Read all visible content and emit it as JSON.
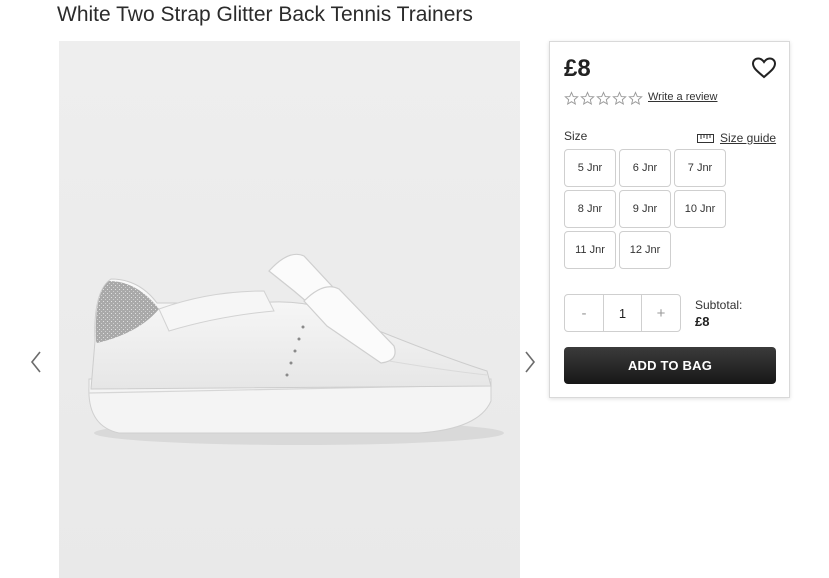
{
  "product": {
    "title": "White Two Strap Glitter Back Tennis Trainers",
    "image_icon": "product-image-white-trainer",
    "gallery_prev_icon": "chevron-left-icon",
    "gallery_next_icon": "chevron-right-icon"
  },
  "panel": {
    "price": "£8",
    "wishlist_icon": "heart-icon",
    "rating": {
      "stars_filled": 0,
      "stars_total": 5,
      "review_link": "Write a review"
    },
    "size_label": "Size",
    "size_guide_label": "Size guide",
    "size_guide_icon": "ruler-icon",
    "sizes": [
      "5 Jnr",
      "6 Jnr",
      "7 Jnr",
      "8 Jnr",
      "9 Jnr",
      "10 Jnr",
      "11 Jnr",
      "12 Jnr"
    ],
    "quantity": {
      "decrement": "-",
      "value": "1",
      "increment": "+"
    },
    "subtotal_label": "Subtotal:",
    "subtotal_value": "£8",
    "add_to_bag": "ADD TO BAG"
  },
  "colors": {
    "add_button": "#222222",
    "border": "#cfcfcf",
    "image_bg": "#efefef"
  }
}
